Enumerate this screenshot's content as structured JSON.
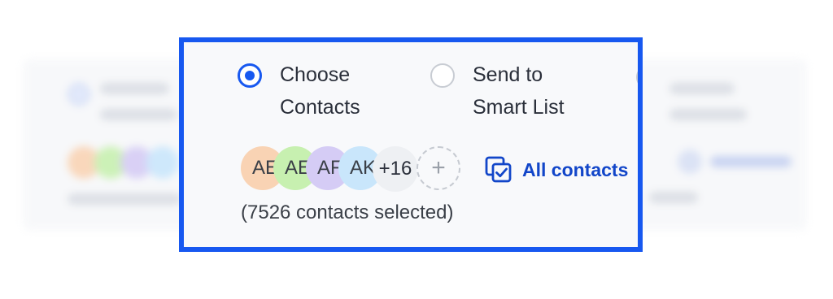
{
  "recipients": {
    "options": [
      {
        "label": "Choose Contacts",
        "checked": true
      },
      {
        "label": "Send to Smart List",
        "checked": false
      }
    ],
    "avatars": [
      {
        "initials": "AE",
        "color": "#f9d3b4"
      },
      {
        "initials": "AE",
        "color": "#c7f0b0"
      },
      {
        "initials": "AF",
        "color": "#d5ccf5"
      },
      {
        "initials": "AK",
        "color": "#c9e6fb"
      }
    ],
    "more_count": "+16",
    "add_symbol": "+",
    "all_contacts_label": "All contacts",
    "all_contacts_icon": "select-all-icon",
    "selected_text": "(7526 contacts selected)"
  },
  "colors": {
    "accent": "#1758f0",
    "link": "#1246c9"
  }
}
